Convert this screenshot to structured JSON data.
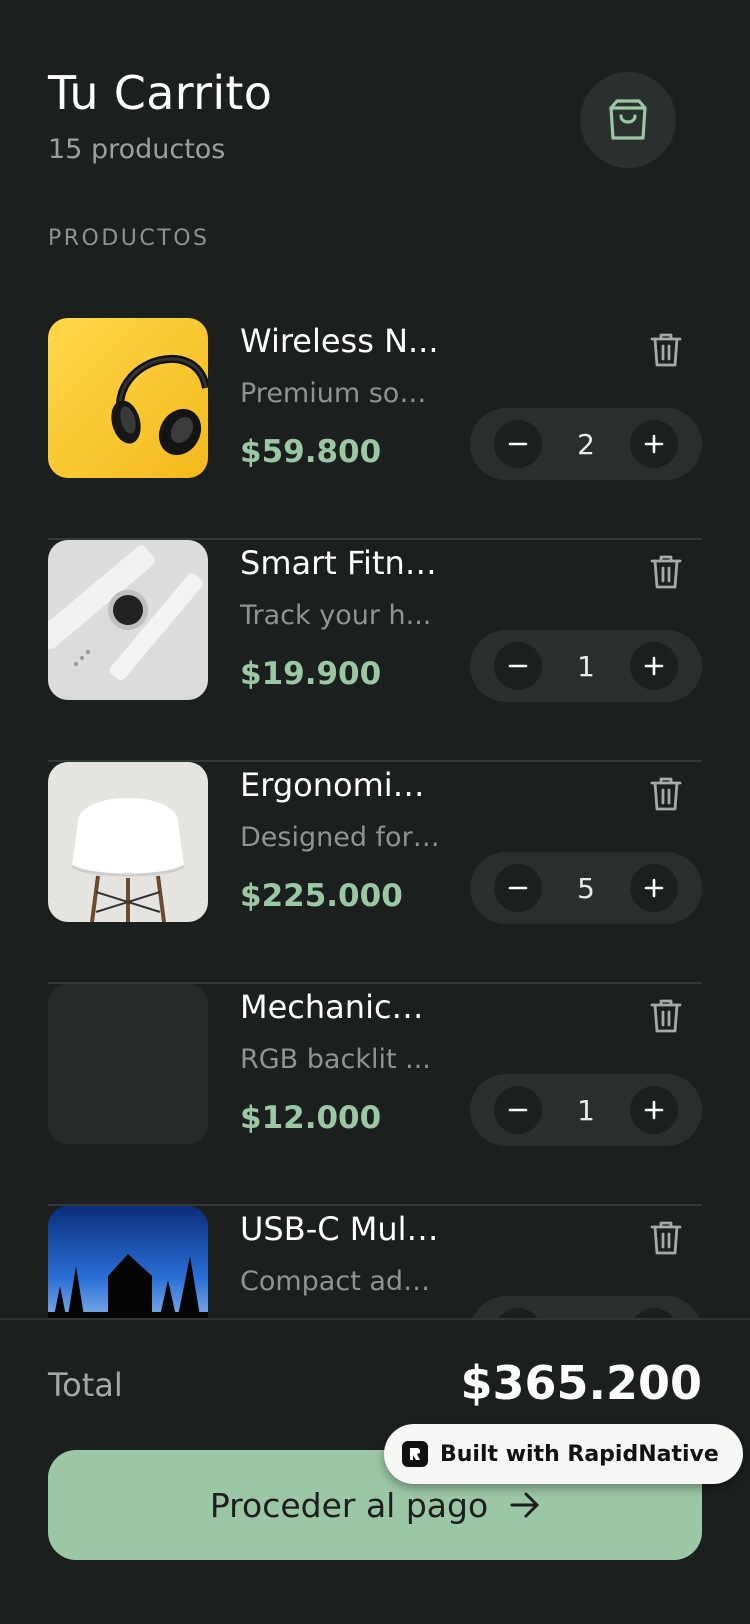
{
  "header": {
    "title": "Tu Carrito",
    "subtitle": "15 productos",
    "cart_icon": "shopping-bag-icon"
  },
  "section_label": "PRODUCTOS",
  "items": [
    {
      "name": "Wireless N...",
      "description": "Premium sou...",
      "price": "$59.800",
      "quantity": "2",
      "image": "headphones"
    },
    {
      "name": "Smart Fitne...",
      "description": "Track your h...",
      "price": "$19.900",
      "quantity": "1",
      "image": "smartwatch"
    },
    {
      "name": "Ergonomic ...",
      "description": "Designed for ...",
      "price": "$225.000",
      "quantity": "5",
      "image": "chair"
    },
    {
      "name": "Mechanical...",
      "description": "RGB backlit ...",
      "price": "$12.000",
      "quantity": "1",
      "image": "none"
    },
    {
      "name": "USB-C Mult...",
      "description": "Compact ada...",
      "price": "",
      "quantity": "",
      "image": "night-cabin"
    }
  ],
  "footer": {
    "total_label": "Total",
    "total_value": "$365.200",
    "checkout_label": "Proceder al pago"
  },
  "badge": {
    "text": "Built with RapidNative"
  },
  "colors": {
    "background": "#1b1f1e",
    "accent": "#9cc7a4",
    "surface": "#2a2f2d"
  }
}
